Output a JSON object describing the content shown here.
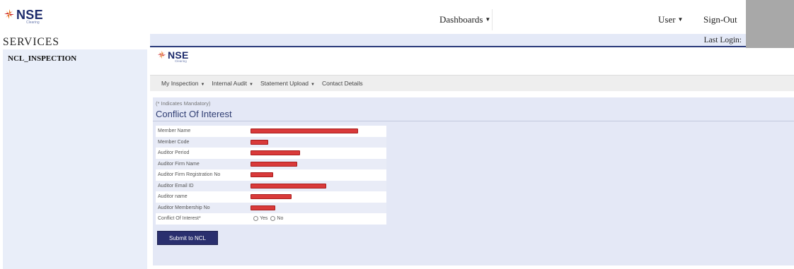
{
  "header": {
    "logo": {
      "name": "NSE",
      "sub": "Clearing"
    },
    "menus": {
      "dashboards": "Dashboards",
      "user": "User",
      "sign_out": "Sign-Out"
    }
  },
  "sidebar": {
    "title": "SERVICES",
    "items": [
      {
        "label": "NCL_INSPECTION"
      }
    ]
  },
  "main": {
    "last_login_label": "Last Login:",
    "app_logo": {
      "name": "NSE",
      "sub": "Clearing"
    },
    "nav": {
      "my_inspection": "My Inspection",
      "internal_audit": "Internal Audit",
      "statement_upload": "Statement Upload",
      "contact_details": "Contact Details"
    },
    "form": {
      "mandatory_note": "(* Indicates Mandatory)",
      "title": "Conflict Of Interest",
      "fields": [
        {
          "label": "Member Name",
          "value": ""
        },
        {
          "label": "Member Code",
          "value": ""
        },
        {
          "label": "Auditor Period",
          "value": ""
        },
        {
          "label": "Auditor Firm Name",
          "value": ""
        },
        {
          "label": "Auditor Firm Registration No",
          "value": ""
        },
        {
          "label": "Auditor Email ID",
          "value": ""
        },
        {
          "label": "Auditor name",
          "value": ""
        },
        {
          "label": "Auditor Membership No",
          "value": ""
        }
      ],
      "conflict_label": "Conflict Of Interest*",
      "options": {
        "yes": "Yes",
        "no": "No"
      },
      "submit_label": "Submit to NCL"
    }
  },
  "colors": {
    "brand_navy": "#2a2f6e",
    "sidebar_bg": "#e9eef9",
    "panel_bg": "#e4e8f6",
    "redaction": "#d93a3a",
    "logo_orange": "#e8731c",
    "logo_red": "#c8202a"
  },
  "icons": {
    "logo": "nse-logo-icon",
    "dropdown": "caret-down-icon"
  }
}
